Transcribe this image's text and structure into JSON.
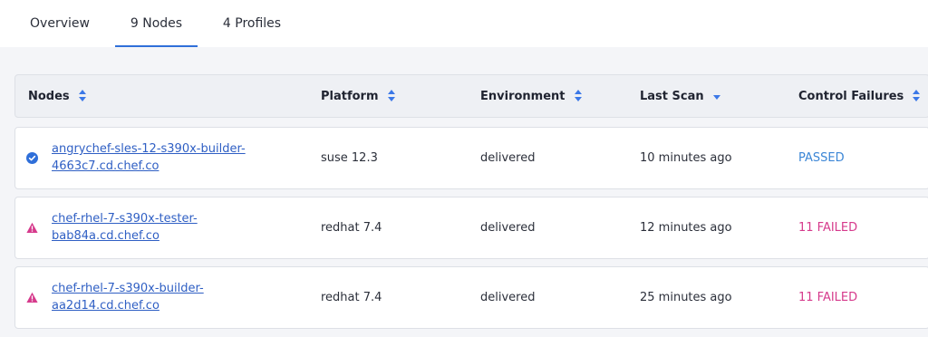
{
  "tabs": [
    {
      "label": "Overview"
    },
    {
      "label": "9 Nodes"
    },
    {
      "label": "4 Profiles"
    }
  ],
  "table": {
    "columns": [
      {
        "label": "Nodes"
      },
      {
        "label": "Platform"
      },
      {
        "label": "Environment"
      },
      {
        "label": "Last Scan"
      },
      {
        "label": "Control Failures"
      }
    ],
    "rows": [
      {
        "name_line1": "angrychef-sles-12-s390x-builder-",
        "name_line2": "4663c7.cd.chef.co",
        "platform": "suse 12.3",
        "environment": "delivered",
        "last_scan": "10 minutes ago",
        "control_failures": "PASSED",
        "status_icon": "check-circle-icon"
      },
      {
        "name_line1": "chef-rhel-7-s390x-tester-",
        "name_line2": "bab84a.cd.chef.co",
        "platform": "redhat 7.4",
        "environment": "delivered",
        "last_scan": "12 minutes ago",
        "control_failures": "11 FAILED",
        "status_icon": "warning-triangle-icon"
      },
      {
        "name_line1": "chef-rhel-7-s390x-builder-",
        "name_line2": "aa2d14.cd.chef.co",
        "platform": "redhat 7.4",
        "environment": "delivered",
        "last_scan": "25 minutes ago",
        "control_failures": "11 FAILED",
        "status_icon": "warning-triangle-icon"
      }
    ]
  },
  "colors": {
    "accent": "#2f6fd9",
    "passed": "#3b86d6",
    "failed": "#d63a8c"
  }
}
